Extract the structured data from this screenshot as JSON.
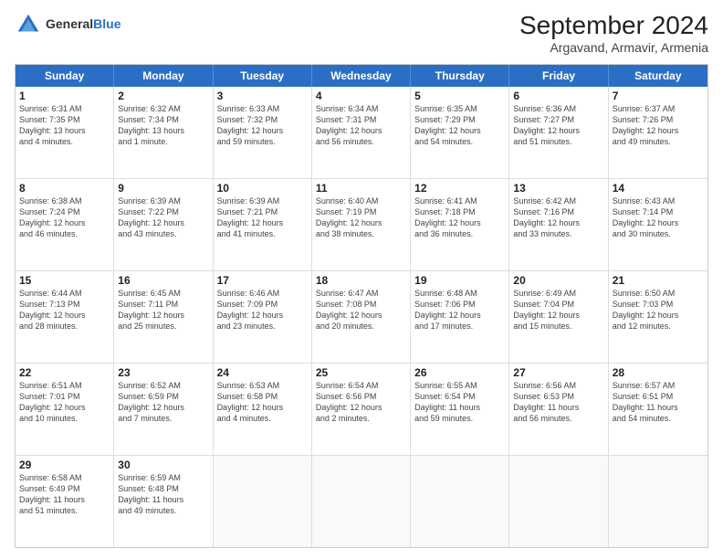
{
  "logo": {
    "text_general": "General",
    "text_blue": "Blue"
  },
  "title": "September 2024",
  "subtitle": "Argavand, Armavir, Armenia",
  "header_days": [
    "Sunday",
    "Monday",
    "Tuesday",
    "Wednesday",
    "Thursday",
    "Friday",
    "Saturday"
  ],
  "weeks": [
    [
      {
        "day": "1",
        "info": "Sunrise: 6:31 AM\nSunset: 7:35 PM\nDaylight: 13 hours\nand 4 minutes."
      },
      {
        "day": "2",
        "info": "Sunrise: 6:32 AM\nSunset: 7:34 PM\nDaylight: 13 hours\nand 1 minute."
      },
      {
        "day": "3",
        "info": "Sunrise: 6:33 AM\nSunset: 7:32 PM\nDaylight: 12 hours\nand 59 minutes."
      },
      {
        "day": "4",
        "info": "Sunrise: 6:34 AM\nSunset: 7:31 PM\nDaylight: 12 hours\nand 56 minutes."
      },
      {
        "day": "5",
        "info": "Sunrise: 6:35 AM\nSunset: 7:29 PM\nDaylight: 12 hours\nand 54 minutes."
      },
      {
        "day": "6",
        "info": "Sunrise: 6:36 AM\nSunset: 7:27 PM\nDaylight: 12 hours\nand 51 minutes."
      },
      {
        "day": "7",
        "info": "Sunrise: 6:37 AM\nSunset: 7:26 PM\nDaylight: 12 hours\nand 49 minutes."
      }
    ],
    [
      {
        "day": "8",
        "info": "Sunrise: 6:38 AM\nSunset: 7:24 PM\nDaylight: 12 hours\nand 46 minutes."
      },
      {
        "day": "9",
        "info": "Sunrise: 6:39 AM\nSunset: 7:22 PM\nDaylight: 12 hours\nand 43 minutes."
      },
      {
        "day": "10",
        "info": "Sunrise: 6:39 AM\nSunset: 7:21 PM\nDaylight: 12 hours\nand 41 minutes."
      },
      {
        "day": "11",
        "info": "Sunrise: 6:40 AM\nSunset: 7:19 PM\nDaylight: 12 hours\nand 38 minutes."
      },
      {
        "day": "12",
        "info": "Sunrise: 6:41 AM\nSunset: 7:18 PM\nDaylight: 12 hours\nand 36 minutes."
      },
      {
        "day": "13",
        "info": "Sunrise: 6:42 AM\nSunset: 7:16 PM\nDaylight: 12 hours\nand 33 minutes."
      },
      {
        "day": "14",
        "info": "Sunrise: 6:43 AM\nSunset: 7:14 PM\nDaylight: 12 hours\nand 30 minutes."
      }
    ],
    [
      {
        "day": "15",
        "info": "Sunrise: 6:44 AM\nSunset: 7:13 PM\nDaylight: 12 hours\nand 28 minutes."
      },
      {
        "day": "16",
        "info": "Sunrise: 6:45 AM\nSunset: 7:11 PM\nDaylight: 12 hours\nand 25 minutes."
      },
      {
        "day": "17",
        "info": "Sunrise: 6:46 AM\nSunset: 7:09 PM\nDaylight: 12 hours\nand 23 minutes."
      },
      {
        "day": "18",
        "info": "Sunrise: 6:47 AM\nSunset: 7:08 PM\nDaylight: 12 hours\nand 20 minutes."
      },
      {
        "day": "19",
        "info": "Sunrise: 6:48 AM\nSunset: 7:06 PM\nDaylight: 12 hours\nand 17 minutes."
      },
      {
        "day": "20",
        "info": "Sunrise: 6:49 AM\nSunset: 7:04 PM\nDaylight: 12 hours\nand 15 minutes."
      },
      {
        "day": "21",
        "info": "Sunrise: 6:50 AM\nSunset: 7:03 PM\nDaylight: 12 hours\nand 12 minutes."
      }
    ],
    [
      {
        "day": "22",
        "info": "Sunrise: 6:51 AM\nSunset: 7:01 PM\nDaylight: 12 hours\nand 10 minutes."
      },
      {
        "day": "23",
        "info": "Sunrise: 6:52 AM\nSunset: 6:59 PM\nDaylight: 12 hours\nand 7 minutes."
      },
      {
        "day": "24",
        "info": "Sunrise: 6:53 AM\nSunset: 6:58 PM\nDaylight: 12 hours\nand 4 minutes."
      },
      {
        "day": "25",
        "info": "Sunrise: 6:54 AM\nSunset: 6:56 PM\nDaylight: 12 hours\nand 2 minutes."
      },
      {
        "day": "26",
        "info": "Sunrise: 6:55 AM\nSunset: 6:54 PM\nDaylight: 11 hours\nand 59 minutes."
      },
      {
        "day": "27",
        "info": "Sunrise: 6:56 AM\nSunset: 6:53 PM\nDaylight: 11 hours\nand 56 minutes."
      },
      {
        "day": "28",
        "info": "Sunrise: 6:57 AM\nSunset: 6:51 PM\nDaylight: 11 hours\nand 54 minutes."
      }
    ],
    [
      {
        "day": "29",
        "info": "Sunrise: 6:58 AM\nSunset: 6:49 PM\nDaylight: 11 hours\nand 51 minutes."
      },
      {
        "day": "30",
        "info": "Sunrise: 6:59 AM\nSunset: 6:48 PM\nDaylight: 11 hours\nand 49 minutes."
      },
      {
        "day": "",
        "info": ""
      },
      {
        "day": "",
        "info": ""
      },
      {
        "day": "",
        "info": ""
      },
      {
        "day": "",
        "info": ""
      },
      {
        "day": "",
        "info": ""
      }
    ]
  ]
}
